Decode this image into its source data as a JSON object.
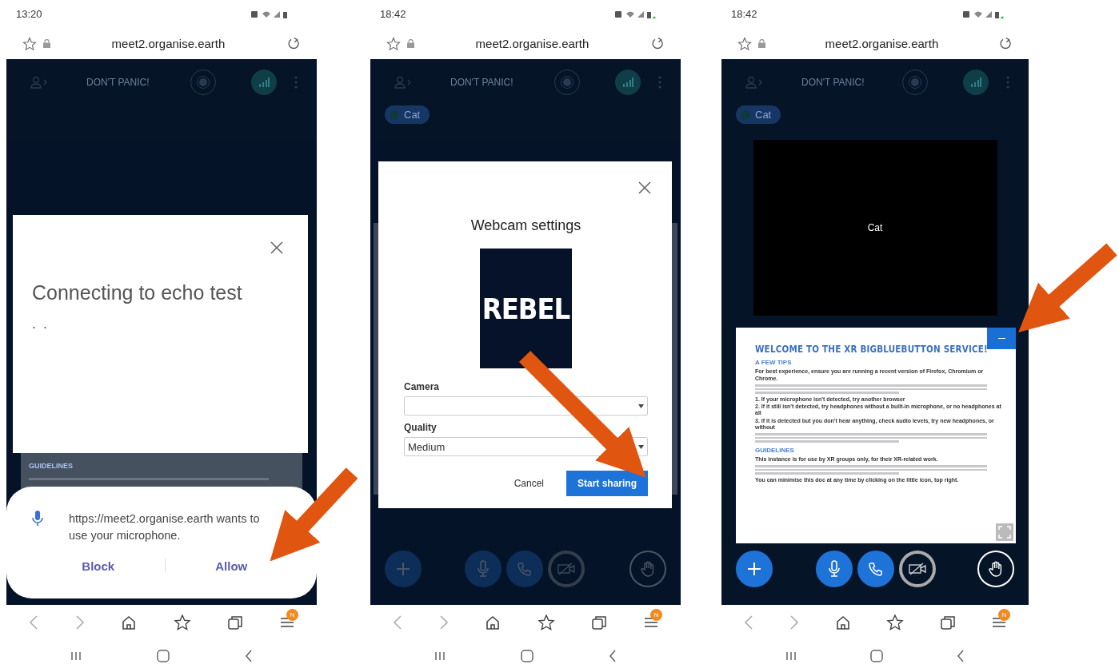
{
  "panels": [
    {
      "kind": "echo",
      "time": "13:20",
      "url": "meet2.organise.earth",
      "header_title": "DON'T PANIC!",
      "menu_badge": "N",
      "dimmed": true,
      "arrow": true,
      "background_doc": {
        "heading": "GUIDELINES"
      },
      "modal": {
        "title": "Connecting to echo test",
        "dots": ". ."
      },
      "prompt": {
        "message": "https://meet2.organise.earth wants to use your microphone.",
        "buttons": [
          "Block",
          "Allow"
        ]
      }
    },
    {
      "kind": "webcam",
      "time": "18:42",
      "url": "meet2.organise.earth",
      "header_title": "DON'T PANIC!",
      "menu_badge": "N",
      "dimmed": true,
      "arrow": true,
      "user_chip": "Cat",
      "dialog": {
        "title": "Webcam settings",
        "logo": "REBEL",
        "camera_label": "Camera",
        "quality_label": "Quality",
        "quality_value": "Medium",
        "cancel": "Cancel",
        "confirm": "Start sharing"
      },
      "controls": [
        {
          "kind": "plus",
          "on": true
        },
        {
          "kind": "mic",
          "on": true
        },
        {
          "kind": "phone",
          "on": true
        },
        {
          "kind": "camera",
          "on": false
        },
        {
          "kind": "hand",
          "on": false
        }
      ]
    },
    {
      "kind": "meeting",
      "time": "18:42",
      "url": "meet2.organise.earth",
      "header_title": "DON'T PANIC!",
      "menu_badge": "N",
      "dimmed": false,
      "arrow": true,
      "user_chip": "Cat",
      "video_tile": "Cat",
      "document": [
        {
          "kind": "title",
          "text": "WELCOME TO THE XR BIGBLUEBUTTON SERVICE!"
        },
        {
          "kind": "heading",
          "text": "A FEW TIPS"
        },
        {
          "kind": "bold",
          "text": "For best experience, ensure you are running a recent version of Firefox, Chromium or Chrome."
        },
        {
          "kind": "blur"
        },
        {
          "kind": "bold",
          "text": "1. If your microphone isn't detected, try another browser"
        },
        {
          "kind": "bold",
          "text": "2. If it still isn't detected, try headphones without a built-in microphone, or no headphones at all"
        },
        {
          "kind": "bold",
          "text": "3. If it is detected but you don't hear anything, check audio levels, try new headphones, or without"
        },
        {
          "kind": "blur"
        },
        {
          "kind": "heading",
          "text": "GUIDELINES"
        },
        {
          "kind": "bold",
          "text": "This instance is for use by XR groups only, for their XR-related work."
        },
        {
          "kind": "blur"
        },
        {
          "kind": "bold",
          "text": "You can minimise this doc at any time by clicking on the little icon, top right."
        }
      ],
      "controls": [
        {
          "kind": "plus",
          "on": true
        },
        {
          "kind": "mic",
          "on": true
        },
        {
          "kind": "phone",
          "on": true
        },
        {
          "kind": "camera",
          "on": false
        },
        {
          "kind": "hand",
          "on": false
        }
      ]
    }
  ]
}
